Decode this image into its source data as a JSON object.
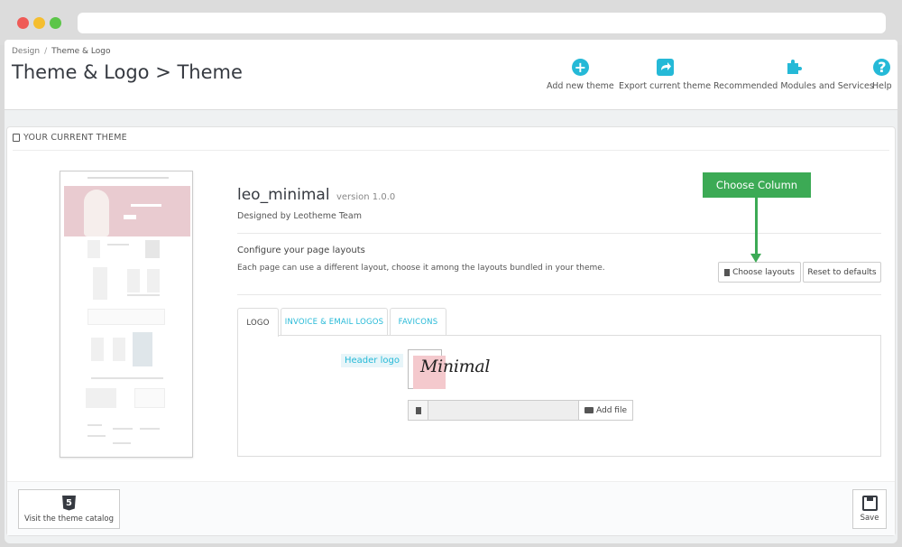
{
  "breadcrumb": {
    "parent": "Design",
    "separator": "/",
    "current": "Theme & Logo"
  },
  "page_title": "Theme & Logo > Theme",
  "toolbar": {
    "add_theme": "Add new theme",
    "export_theme": "Export current theme",
    "recommended": "Recommended Modules and Services",
    "help": "Help",
    "help_glyph": "?",
    "add_glyph": "+"
  },
  "panel": {
    "heading": "YOUR CURRENT THEME"
  },
  "theme": {
    "name": "leo_minimal",
    "version": "version 1.0.0",
    "designed_by": "Designed by Leotheme Team"
  },
  "layouts": {
    "title": "Configure your page layouts",
    "description": "Each page can use a different layout, choose it among the layouts bundled in your theme.",
    "choose_button": "Choose layouts",
    "reset_button": "Reset to defaults"
  },
  "callout": {
    "text": "Choose Column"
  },
  "tabs": [
    {
      "label": "LOGO"
    },
    {
      "label": "INVOICE & EMAIL LOGOS"
    },
    {
      "label": "FAVICONS"
    }
  ],
  "logo": {
    "label": "Header logo",
    "logo_text": "Minimal",
    "add_file": "Add file"
  },
  "footer": {
    "catalog_button": "Visit the theme catalog",
    "catalog_icon_text": "5",
    "save_button": "Save"
  },
  "colors": {
    "accent": "#25b9d7",
    "callout": "#3caa55",
    "logo_bg": "#f4c9cd",
    "title": "#363a41"
  },
  "icons": {
    "add_theme": "plus-circle-icon",
    "export_theme": "share-icon",
    "recommended": "puzzle-icon",
    "help": "question-circle-icon"
  }
}
